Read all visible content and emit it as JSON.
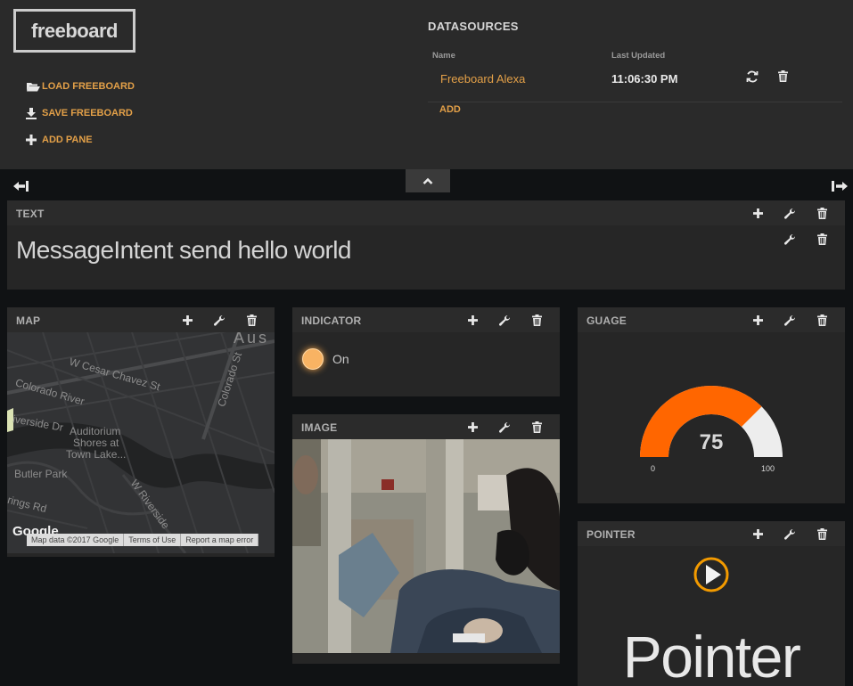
{
  "header": {
    "logo": "freeboard",
    "menu": [
      {
        "label": "LOAD FREEBOARD",
        "icon": "folder-open-icon"
      },
      {
        "label": "SAVE FREEBOARD",
        "icon": "download-icon"
      },
      {
        "label": "ADD PANE",
        "icon": "plus-icon"
      }
    ]
  },
  "datasources": {
    "title": "DATASOURCES",
    "col_name": "Name",
    "col_updated": "Last Updated",
    "rows": [
      {
        "name": "Freeboard Alexa",
        "last_updated": "11:06:30 PM"
      }
    ],
    "add_label": "ADD"
  },
  "panes": {
    "text": {
      "title": "TEXT",
      "value": "MessageIntent send hello world"
    },
    "map": {
      "title": "MAP",
      "labels": [
        "Aus",
        "W Cesar Chavez St",
        "Colorado River",
        "Colorado St",
        "iverside Dr",
        "Auditorium",
        "Shores at",
        "Town Lake...",
        "Butler Park",
        "rings Rd",
        "W Riverside"
      ],
      "google": "Google",
      "footer": [
        "Map data ©2017 Google",
        "Terms of Use",
        "Report a map error"
      ]
    },
    "indicator": {
      "title": "INDICATOR",
      "status": "On"
    },
    "image": {
      "title": "IMAGE"
    },
    "gauge": {
      "title": "GUAGE",
      "value": 75,
      "min": 0,
      "max": 100
    },
    "pointer": {
      "title": "POINTER",
      "text": "Pointer"
    }
  },
  "colors": {
    "accent": "#e3a048",
    "gauge_fill": "#ff6600",
    "gauge_track": "#ededed",
    "pointer_ring": "#f29a00"
  }
}
